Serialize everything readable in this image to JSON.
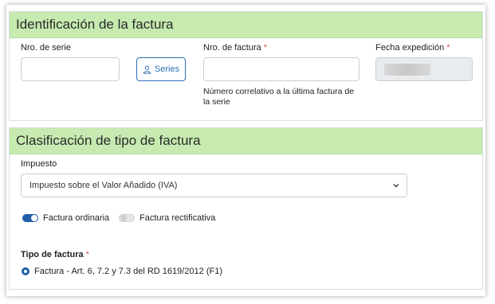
{
  "identificacion": {
    "title": "Identificación de la factura",
    "nro_serie_label": "Nro. de serie",
    "series_button": "Series",
    "nro_factura_label": "Nro. de factura",
    "nro_factura_required": "*",
    "nro_factura_help": "Número correlativo a la última factura de la serie",
    "fecha_label": "Fecha expedición",
    "fecha_required": "*"
  },
  "clasificacion": {
    "title": "Clasificación de tipo de factura",
    "impuesto_label": "Impuesto",
    "impuesto_value": "Impuesto sobre el Valor Añadido (IVA)",
    "toggle_ordinaria": "Factura ordinaria",
    "toggle_ordinaria_on": true,
    "toggle_rectificativa": "Factura rectificativa",
    "toggle_rectificativa_on": false,
    "tipo_label": "Tipo de factura",
    "tipo_required": "*",
    "tipo_option_prefix": "Factura - ",
    "tipo_option_text": "Art. 6, 7.2 y 7.3 del RD 1619/2012 (F1)"
  },
  "colors": {
    "header_bg": "#c6eab0",
    "accent": "#1f5ea8",
    "required": "#d9534f"
  }
}
